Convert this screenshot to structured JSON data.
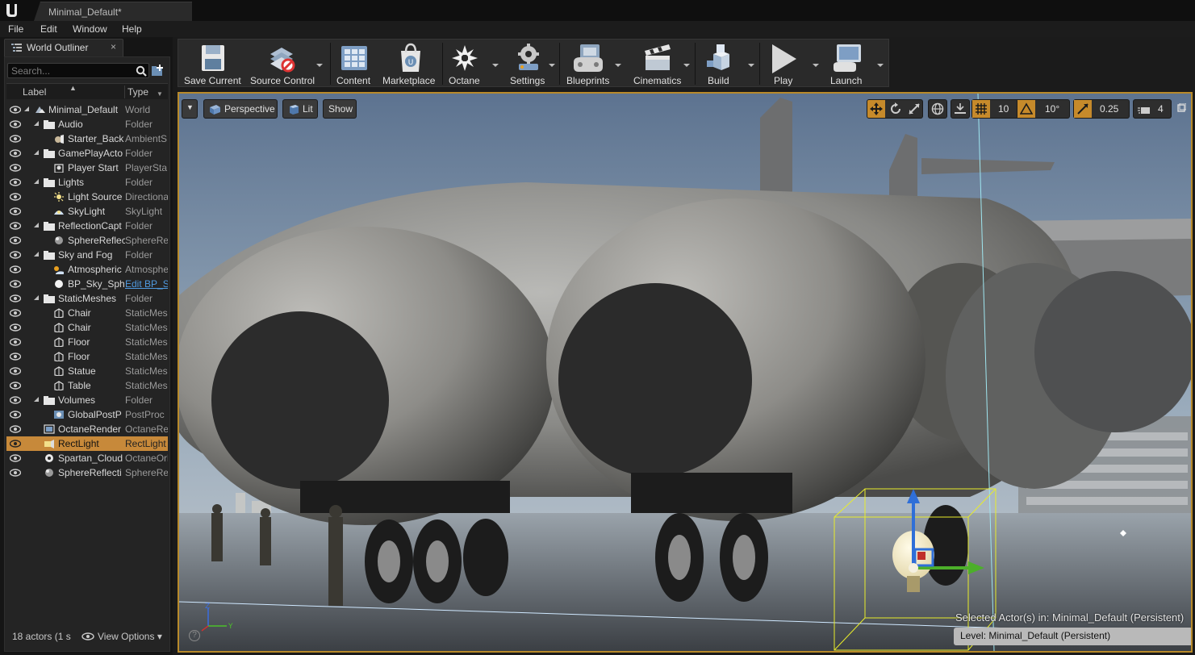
{
  "titlebar": {
    "tab_title": "Minimal_Default*"
  },
  "menu": [
    "File",
    "Edit",
    "Window",
    "Help"
  ],
  "outliner": {
    "tab_label": "World Outliner",
    "close_glyph": "×",
    "search_placeholder": "Search...",
    "col_label": "Label",
    "col_type": "Type",
    "rows": [
      {
        "label": "Minimal_Default",
        "type": "World",
        "icon": "world-icon",
        "expand": true,
        "indent": 0
      },
      {
        "label": "Audio",
        "type": "Folder",
        "icon": "folder-icon",
        "expand": true,
        "indent": 1
      },
      {
        "label": "Starter_Back",
        "type": "AmbientS",
        "icon": "sound-icon",
        "expand": false,
        "indent": 2
      },
      {
        "label": "GamePlayActo",
        "type": "Folder",
        "icon": "folder-icon",
        "expand": true,
        "indent": 1
      },
      {
        "label": "Player Start",
        "type": "PlayerSta",
        "icon": "player-start-icon",
        "expand": false,
        "indent": 2
      },
      {
        "label": "Lights",
        "type": "Folder",
        "icon": "folder-icon",
        "expand": true,
        "indent": 1
      },
      {
        "label": "Light Source",
        "type": "Directiona",
        "icon": "directional-light-icon",
        "expand": false,
        "indent": 2
      },
      {
        "label": "SkyLight",
        "type": "SkyLight",
        "icon": "skylight-icon",
        "expand": false,
        "indent": 2
      },
      {
        "label": "ReflectionCapt",
        "type": "Folder",
        "icon": "folder-icon",
        "expand": true,
        "indent": 1
      },
      {
        "label": "SphereReflec",
        "type": "SphereRe",
        "icon": "sphere-reflection-icon",
        "expand": false,
        "indent": 2
      },
      {
        "label": "Sky and Fog",
        "type": "Folder",
        "icon": "folder-icon",
        "expand": true,
        "indent": 1
      },
      {
        "label": "Atmospheric",
        "type": "Atmosphe",
        "icon": "atmosphere-icon",
        "expand": false,
        "indent": 2
      },
      {
        "label": "BP_Sky_Sph",
        "type": "Edit BP_S",
        "icon": "sphere-icon",
        "expand": false,
        "indent": 2,
        "link": true
      },
      {
        "label": "StaticMeshes",
        "type": "Folder",
        "icon": "folder-icon",
        "expand": true,
        "indent": 1
      },
      {
        "label": "Chair",
        "type": "StaticMes",
        "icon": "static-mesh-icon",
        "expand": false,
        "indent": 2
      },
      {
        "label": "Chair",
        "type": "StaticMes",
        "icon": "static-mesh-icon",
        "expand": false,
        "indent": 2
      },
      {
        "label": "Floor",
        "type": "StaticMes",
        "icon": "static-mesh-icon",
        "expand": false,
        "indent": 2
      },
      {
        "label": "Floor",
        "type": "StaticMes",
        "icon": "static-mesh-icon",
        "expand": false,
        "indent": 2
      },
      {
        "label": "Statue",
        "type": "StaticMes",
        "icon": "static-mesh-icon",
        "expand": false,
        "indent": 2
      },
      {
        "label": "Table",
        "type": "StaticMes",
        "icon": "static-mesh-icon",
        "expand": false,
        "indent": 2
      },
      {
        "label": "Volumes",
        "type": "Folder",
        "icon": "folder-icon",
        "expand": true,
        "indent": 1
      },
      {
        "label": "GlobalPostP",
        "type": "PostProc",
        "icon": "post-process-icon",
        "expand": false,
        "indent": 2
      },
      {
        "label": "OctaneRender",
        "type": "OctaneRe",
        "icon": "octane-render-icon",
        "expand": false,
        "indent": 1
      },
      {
        "label": "RectLight",
        "type": "RectLight",
        "icon": "rect-light-icon",
        "expand": false,
        "indent": 1,
        "selected": true
      },
      {
        "label": "Spartan_Cloud",
        "type": "OctaneOrl",
        "icon": "octane-icon",
        "expand": false,
        "indent": 1
      },
      {
        "label": "SphereReflecti",
        "type": "SphereRe",
        "icon": "sphere-reflection-icon",
        "expand": false,
        "indent": 1
      }
    ],
    "actor_count": "18 actors (1 s",
    "view_options": "View Options"
  },
  "toolbar": {
    "save_current": "Save Current",
    "source_control": "Source Control",
    "content": "Content",
    "marketplace": "Marketplace",
    "octane": "Octane",
    "settings": "Settings",
    "blueprints": "Blueprints",
    "cinematics": "Cinematics",
    "build": "Build",
    "play": "Play",
    "launch": "Launch"
  },
  "viewport": {
    "perspective": "Perspective",
    "lit": "Lit",
    "show": "Show",
    "grid_snap": "10",
    "rotation_snap": "10°",
    "scale_snap": "0.25",
    "camera_speed": "4",
    "selected_actors": "Selected Actor(s) in:  Minimal_Default (Persistent)",
    "level": "Level:  Minimal_Default (Persistent)",
    "help": "?"
  },
  "colors": {
    "selection": "#c7893a",
    "viewport_border": "#b88a2a",
    "link": "#4f9ae0"
  }
}
